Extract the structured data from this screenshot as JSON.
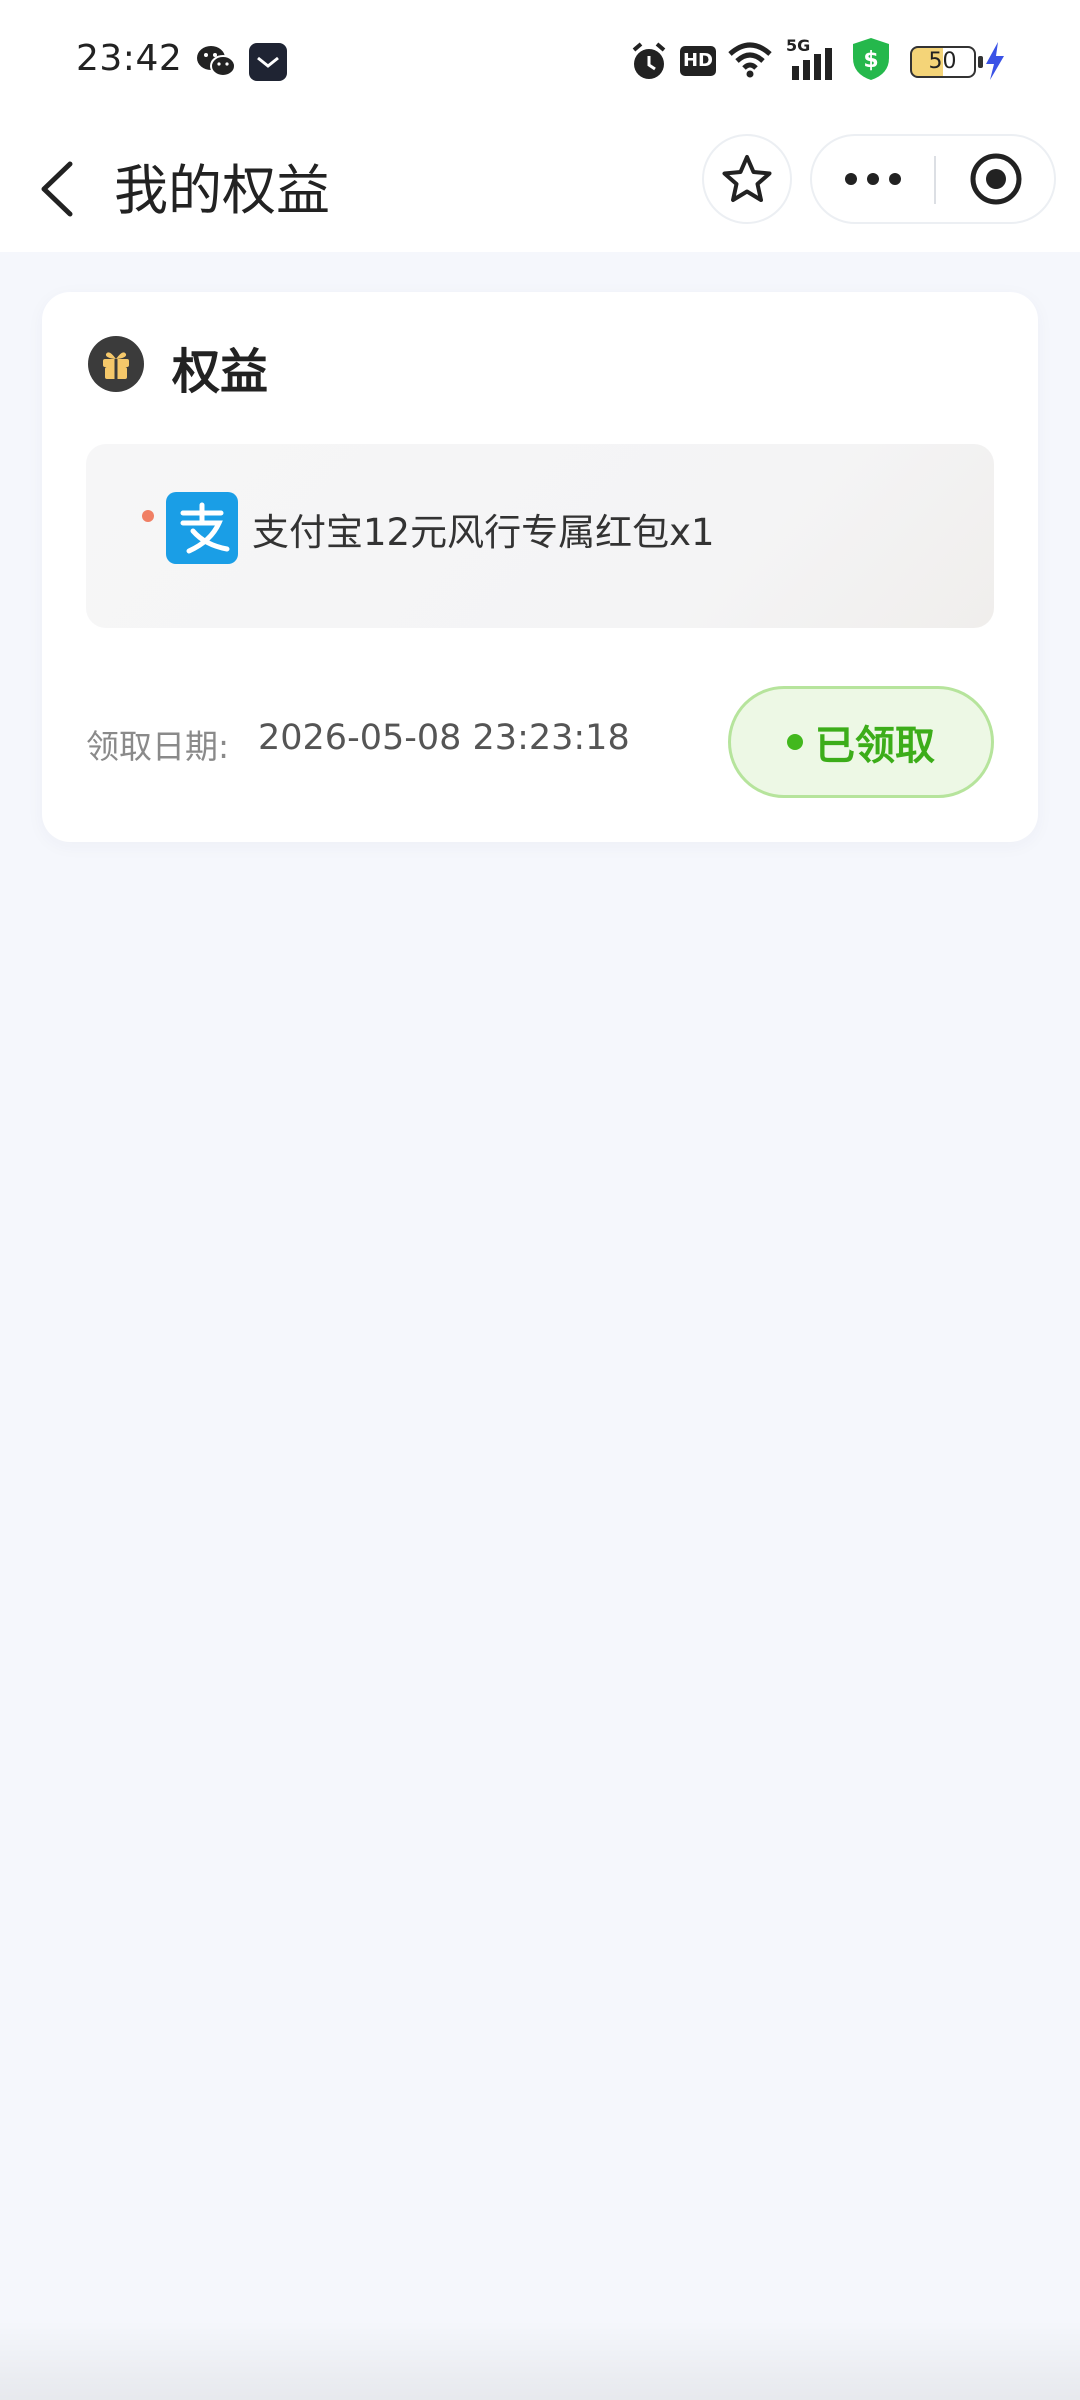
{
  "status_bar": {
    "time": "23:42",
    "hd_badge": "HD",
    "network": "5G",
    "battery_level": "50",
    "icons": [
      "wechat-icon",
      "app-notification-icon",
      "alarm-icon",
      "hd-icon",
      "wifi-icon",
      "signal-icon",
      "shield-dollar-icon",
      "battery-icon",
      "charging-icon"
    ]
  },
  "nav": {
    "title": "我的权益",
    "icons": [
      "back-icon",
      "star-icon",
      "more-icon",
      "target-icon"
    ]
  },
  "card": {
    "title": "权益",
    "benefit_text": "支付宝12元风行专属红包x1",
    "date_label": "领取日期:",
    "date_value": "2026-05-08 23:23:18",
    "status_label": "已领取"
  },
  "colors": {
    "background": "#f5f7fc",
    "alipay_blue": "#1a9ee6",
    "claimed_green": "#3cad19",
    "claimed_bg": "#edf8e5",
    "dot_red": "#f07f64"
  }
}
